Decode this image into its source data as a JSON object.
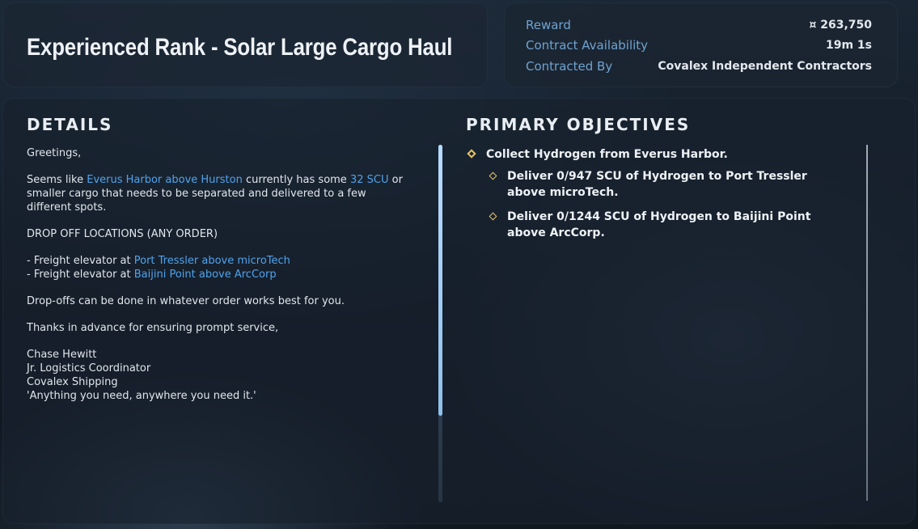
{
  "header": {
    "title": "Experienced Rank - Solar Large Cargo Haul"
  },
  "meta": {
    "reward_label": "Reward",
    "reward_value": "¤ 263,750",
    "availability_label": "Contract Availability",
    "availability_value": "19m 1s",
    "contracted_by_label": "Contracted By",
    "contracted_by_value": "Covalex Independent Contractors"
  },
  "details": {
    "heading": "DETAILS",
    "greeting": "Greetings,",
    "p1_a": "Seems like ",
    "p1_link1": "Everus Harbor above Hurston",
    "p1_b": " currently has some ",
    "p1_link2": "32 SCU",
    "p1_c": " or smaller cargo that needs to be separated and delivered to a few different spots.",
    "dropoff_heading": "DROP OFF LOCATIONS (ANY ORDER)",
    "loc1_prefix": "- Freight elevator at ",
    "loc1_link": "Port Tressler above microTech",
    "loc2_prefix": "- Freight elevator at ",
    "loc2_link": "Baijini Point above ArcCorp",
    "order_note": "Drop-offs can be done in whatever order works best for you.",
    "thanks": "Thanks in advance for ensuring prompt service,",
    "sig_name": "Chase Hewitt",
    "sig_title": "Jr. Logistics Coordinator",
    "sig_company": "Covalex Shipping",
    "sig_motto": "'Anything you need, anywhere you need it.'"
  },
  "objectives": {
    "heading": "PRIMARY OBJECTIVES",
    "items": [
      {
        "text": "Collect Hydrogen from Everus Harbor."
      },
      {
        "text": "Deliver 0/947 SCU of Hydrogen to Port Tressler above microTech."
      },
      {
        "text": "Deliver 0/1244 SCU of Hydrogen to Baijini Point above ArcCorp."
      }
    ]
  },
  "colors": {
    "accent_link": "#4fa3ec",
    "meta_label": "#6fa3cf",
    "objective_marker": "#e9c56a"
  }
}
